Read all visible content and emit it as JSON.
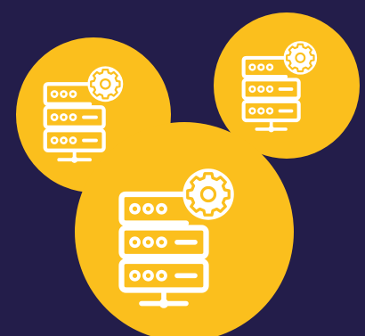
{
  "colors": {
    "background": "#231d4a",
    "circle": "#fbbf1d",
    "icon": "#ffffff"
  },
  "illustration": {
    "icon_name": "server-settings-icon",
    "icon_count": 3
  }
}
